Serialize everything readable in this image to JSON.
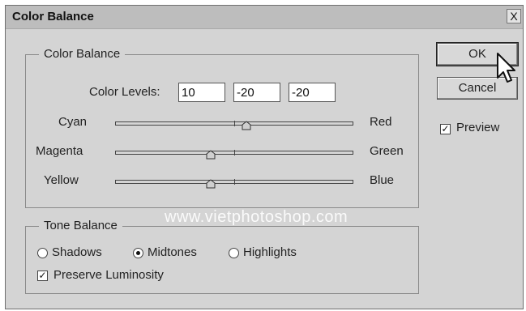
{
  "window": {
    "title": "Color Balance",
    "close_label": "X"
  },
  "color_balance": {
    "legend": "Color Balance",
    "levels_label": "Color Levels:",
    "levels": [
      "10",
      "-20",
      "-20"
    ],
    "sliders": [
      {
        "left": "Cyan",
        "right": "Red",
        "value": 10
      },
      {
        "left": "Magenta",
        "right": "Green",
        "value": -20
      },
      {
        "left": "Yellow",
        "right": "Blue",
        "value": -20
      }
    ],
    "slider_range": [
      -100,
      100
    ]
  },
  "tone_balance": {
    "legend": "Tone Balance",
    "options": [
      "Shadows",
      "Midtones",
      "Highlights"
    ],
    "selected": "Midtones",
    "preserve_label": "Preserve Luminosity",
    "preserve_checked": true
  },
  "buttons": {
    "ok": "OK",
    "cancel": "Cancel"
  },
  "preview": {
    "label": "Preview",
    "checked": true
  },
  "watermark": "www.vietphotoshop.com"
}
